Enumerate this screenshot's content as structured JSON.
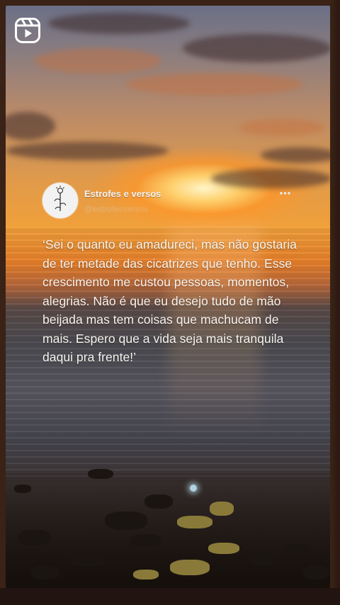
{
  "header": {
    "reels_icon": "reels-icon"
  },
  "post": {
    "author_name": "Estrofes e versos",
    "author_handle": "@estrofesversos",
    "more_icon": "more-horizontal-icon",
    "more_label": "•••",
    "quote": "‘Sei o quanto eu amadureci, mas não gostaria de ter metade das cicatrizes que tenho. Esse crescimento me custou pessoas, momentos, alegrias. Não é que eu desejo tudo de mão beijada mas tem coisas que machucam de mais. Espero que a vida seja mais tranquila daqui pra frente!’"
  },
  "colors": {
    "sun": "#fff5c8",
    "sky_orange": "#f1a03a",
    "text": "#f6f3ee",
    "progress": "#c8f0ff"
  }
}
